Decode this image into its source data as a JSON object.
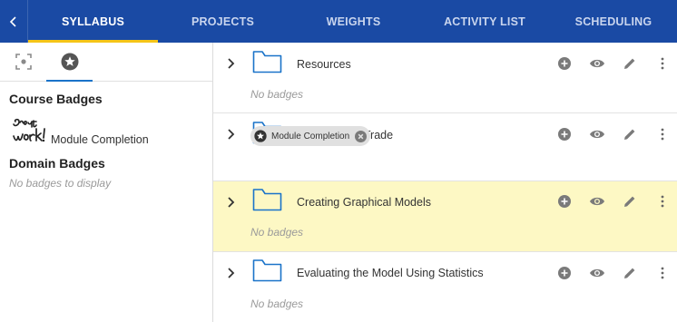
{
  "nav": {
    "back_icon": "chevron-left-icon",
    "tabs": [
      {
        "label": "SYLLABUS",
        "active": true
      },
      {
        "label": "PROJECTS",
        "active": false
      },
      {
        "label": "WEIGHTS",
        "active": false
      },
      {
        "label": "ACTIVITY LIST",
        "active": false
      },
      {
        "label": "SCHEDULING",
        "active": false
      }
    ],
    "colors": {
      "bar": "#1a4aa4",
      "active_underline": "#f5c518"
    }
  },
  "left_panel": {
    "tabs": [
      {
        "icon": "focus-frame-icon",
        "active": false
      },
      {
        "icon": "star-badge-icon",
        "active": true
      }
    ],
    "course_badges": {
      "heading": "Course Badges",
      "items": [
        {
          "image": "great-work-badge-image",
          "image_text": "great work!",
          "label": "Module Completion"
        }
      ]
    },
    "domain_badges": {
      "heading": "Domain Badges",
      "empty_text": "No badges to display"
    }
  },
  "modules": [
    {
      "title": "Resources",
      "empty_text": "No badges",
      "badges": [],
      "highlighted": false
    },
    {
      "title": "Tools Of The Trade",
      "empty_text": "",
      "badges": [
        {
          "label": "Module Completion"
        }
      ],
      "highlighted": false
    },
    {
      "title": "Creating Graphical Models",
      "empty_text": "No badges",
      "badges": [],
      "highlighted": true
    },
    {
      "title": "Evaluating the Model Using Statistics",
      "empty_text": "No badges",
      "badges": [],
      "highlighted": false
    }
  ],
  "row_actions": [
    "add-circle-icon",
    "eye-icon",
    "pencil-icon",
    "more-vertical-icon"
  ],
  "colors": {
    "highlight_row": "#fdf8c4",
    "folder": "#1a73c9",
    "icon_grey": "#7a7a7a"
  }
}
